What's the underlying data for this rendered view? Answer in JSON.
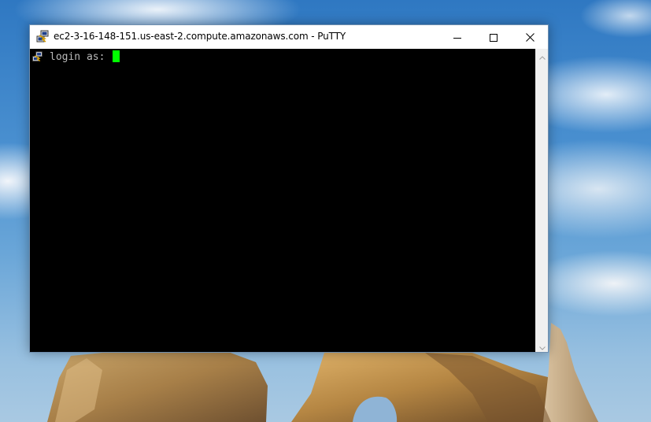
{
  "window": {
    "title": "ec2-3-16-148-151.us-east-2.compute.amazonaws.com - PuTTY",
    "app_icon": "putty-icon",
    "controls": {
      "minimize": "minimize-icon",
      "maximize": "maximize-icon",
      "close": "close-icon"
    }
  },
  "terminal": {
    "background": "#000000",
    "text_color": "#bbbbbb",
    "cursor_color": "#00ff00",
    "line": "login as: "
  },
  "scrollbar": {
    "up_icon": "chevron-up-icon",
    "down_icon": "chevron-down-icon"
  }
}
